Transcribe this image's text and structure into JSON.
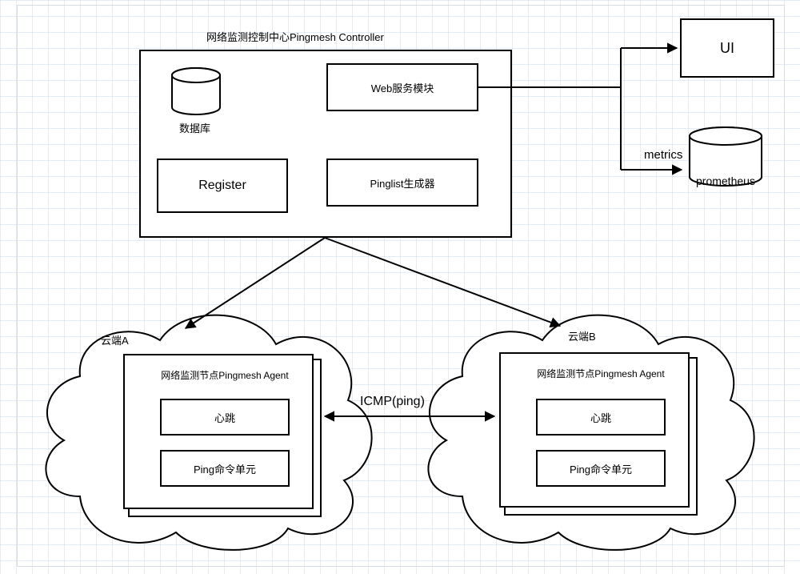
{
  "controller": {
    "title": "网络监测控制中心Pingmesh Controller",
    "db": "数据库",
    "web": "Web服务模块",
    "register": "Register",
    "pinglist": "Pinglist生成器"
  },
  "external": {
    "ui": "UI",
    "metrics_label": "metrics",
    "prometheus": "prometheus"
  },
  "clouds": {
    "a_label": "云端A",
    "b_label": "云端B"
  },
  "agent": {
    "title": "网络监测节点Pingmesh Agent",
    "heartbeat": "心跳",
    "ping_unit": "Ping命令单元"
  },
  "link": {
    "icmp": "ICMP(ping)"
  }
}
